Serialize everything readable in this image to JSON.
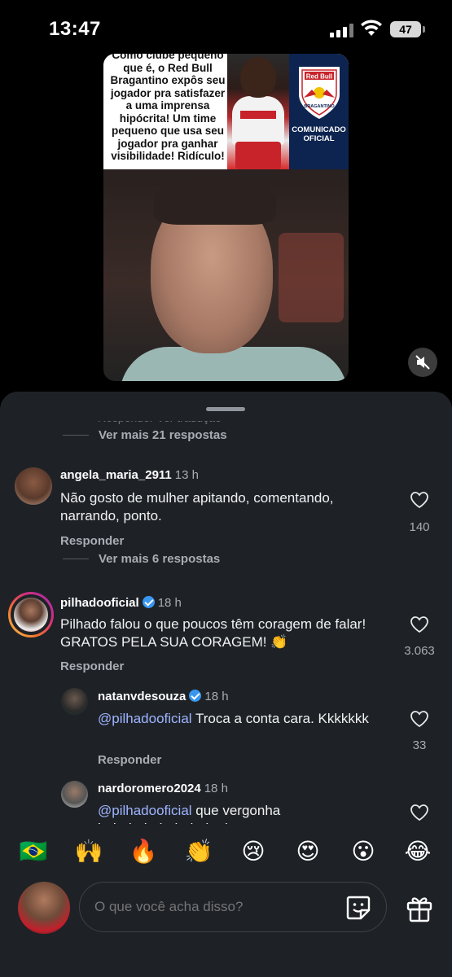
{
  "status_bar": {
    "time": "13:47",
    "battery": "47"
  },
  "video": {
    "caption": "Como clube pequeno que é, o Red Bull Bragantino expôs seu jogador pra satisfazer a uma imprensa hipócrita! Um time pequeno que usa seu jogador pra ganhar visibilidade! Ridículo! O Gustavo não merecia!",
    "club_panel_text": "COMUNICADO OFICIAL",
    "logo_text": "Red Bull",
    "logo_subtext": "BRAGANTINO"
  },
  "comments": {
    "faded_top": "Responder      Ver tradução",
    "view_more_1": "Ver mais 21 respostas",
    "c1": {
      "username": "angela_maria_2911",
      "time": "13 h",
      "text": "Não gosto de mulher apitando, comentando, narrando,  ponto.",
      "reply": "Responder",
      "likes": "140",
      "view_more": "Ver mais 6 respostas"
    },
    "c2": {
      "username": "pilhadooficial",
      "time": "18 h",
      "text": "Pilhado falou o que poucos têm coragem de falar! GRATOS PELA SUA CORAGEM! 👏",
      "reply": "Responder",
      "likes": "3.063"
    },
    "r1": {
      "username": "natanvdesouza",
      "time": "18 h",
      "mention": "@pilhadooficial",
      "text": " Troca a conta cara. Kkkkkkk",
      "reply": "Responder",
      "likes": "33"
    },
    "r2": {
      "username": "nardoromero2024",
      "time": "18 h",
      "mention": "@pilhadooficial",
      "text": " que vergonha hahahahahahahah ele mesmo se"
    }
  },
  "emoji_bar": [
    "🇧🇷",
    "🙌",
    "🔥",
    "👏",
    "😢",
    "😍",
    "😮",
    "😂"
  ],
  "input": {
    "placeholder": "O que você acha disso?"
  },
  "icons": {
    "mute": "speaker-muted-icon",
    "like": "heart-outline-icon",
    "sticker": "sticker-icon",
    "gift": "gift-icon",
    "verified": "verified-badge-icon"
  },
  "colors": {
    "sheet_bg": "#1e2227",
    "mention": "#9fb4ff",
    "verified": "#3897f0",
    "muted_text": "#a8adb3"
  }
}
